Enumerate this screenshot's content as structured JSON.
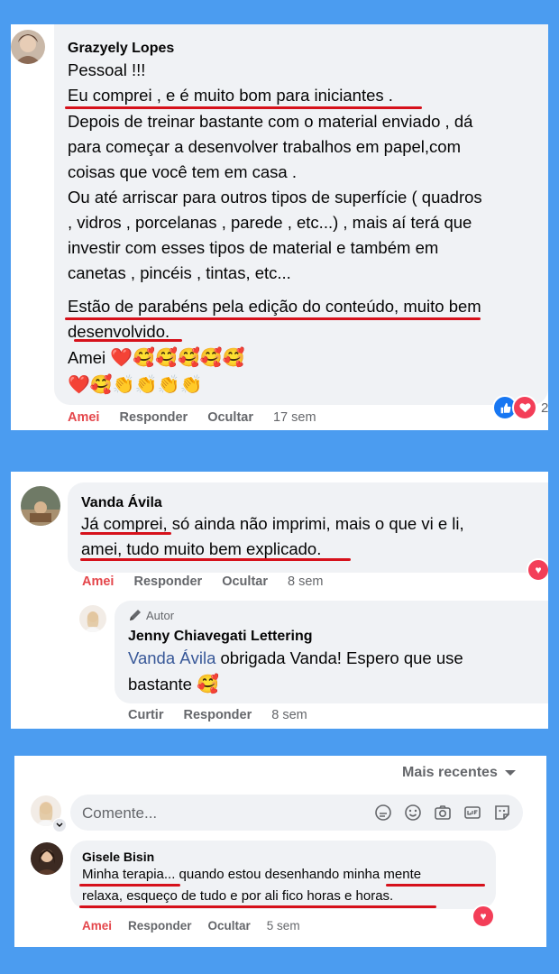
{
  "comment1": {
    "author": "Grazyely Lopes",
    "lines": [
      "Pessoal !!!",
      "Eu comprei , e é muito bom para iniciantes .",
      "Depois de treinar bastante com o material enviado , dá",
      "para começar a desenvolver trabalhos em papel,com",
      "coisas que você tem em casa .",
      "Ou até arriscar para outros tipos de superfície ( quadros",
      ", vidros , porcelanas , parede , etc...) , mais aí terá que",
      "investir com esses tipos de material e também em",
      "canetas , pincéis , tintas, etc...",
      "Estão de parabéns pela edição do conteúdo, muito bem",
      "desenvolvido."
    ],
    "amei_text": "Amei",
    "emoji_row1": [
      "❤️",
      "🥰",
      "🥰",
      "🥰",
      "🥰",
      "🥰"
    ],
    "emoji_row2": [
      "❤️",
      "🥰",
      "👏",
      "👏",
      "👏",
      "👏"
    ],
    "actions": {
      "love": "Amei",
      "reply": "Responder",
      "hide": "Ocultar",
      "time": "17 sem"
    },
    "reaction_count": "2"
  },
  "comment2": {
    "author": "Vanda Ávila",
    "lines": [
      "Já comprei, só ainda não imprimi, mais o que vi e li,",
      "amei, tudo muito bem explicado."
    ],
    "actions": {
      "love": "Amei",
      "reply": "Responder",
      "hide": "Ocultar",
      "time": "8 sem"
    },
    "reply": {
      "badge": "Autor",
      "author": "Jenny Chiavegati Lettering",
      "mention": "Vanda Ávila",
      "text1": " obrigada Vanda! Espero que use",
      "text2": "bastante",
      "emoji": "🥰",
      "actions": {
        "like": "Curtir",
        "reply": "Responder",
        "time": "8 sem"
      }
    }
  },
  "comment3": {
    "sort_label": "Mais recentes",
    "composer_placeholder": "Comente...",
    "author": "Gisele Bisin",
    "lines": [
      "Minha terapia... quando estou desenhando minha mente",
      "relaxa, esqueço de tudo e por ali fico horas e horas."
    ],
    "actions": {
      "love": "Amei",
      "reply": "Responder",
      "hide": "Ocultar",
      "time": "5 sem"
    }
  },
  "colors": {
    "background": "#4b9cf0",
    "bubble": "#f0f2f5",
    "underline": "#d6111b",
    "love": "#e4464b",
    "meta": "#65676b",
    "mention": "#385898"
  }
}
